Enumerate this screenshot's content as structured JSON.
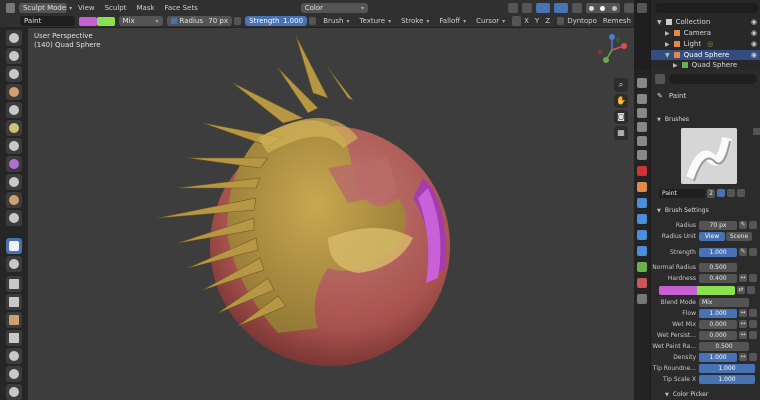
{
  "header": {
    "mode_label": "Sculpt Mode",
    "menus": [
      "View",
      "Sculpt",
      "Mask",
      "Face Sets"
    ],
    "color_field": "Color",
    "brush_name": "Paint",
    "blend": "Mix",
    "radius_label": "Radius",
    "radius_value": "70 px",
    "strength_label": "Strength",
    "strength_value": "1.000",
    "dropdowns": [
      "Brush",
      "Texture",
      "Stroke",
      "Falloff",
      "Cursor"
    ],
    "axes": [
      "X",
      "Y",
      "Z"
    ],
    "dyntopo": "Dyntopo",
    "remesh": "Remesh",
    "primary_color": "#c85fd3",
    "secondary_color": "#8be04e"
  },
  "viewport": {
    "perspective": "User Perspective",
    "object": "(140) Quad Sphere"
  },
  "outliner": {
    "search_placeholder": "",
    "items": [
      {
        "label": "Collection"
      },
      {
        "label": "Camera"
      },
      {
        "label": "Light"
      },
      {
        "label": "Quad Sphere"
      },
      {
        "label": "Quad Sphere"
      }
    ]
  },
  "properties": {
    "tool_name": "Paint",
    "brushes_header": "Brushes",
    "brush_name": "Paint",
    "brush_users": "2",
    "brush_settings_header": "Brush Settings",
    "radius_label": "Radius",
    "radius_value": "70 px",
    "radius_unit_label": "Radius Unit",
    "radius_unit_view": "View",
    "radius_unit_scene": "Scene",
    "strength_label": "Strength",
    "strength_value": "1.000",
    "normal_radius_label": "Normal Radius",
    "normal_radius_value": "0.500",
    "hardness_label": "Hardness",
    "hardness_value": "0.400",
    "blend_mode_label": "Blend Mode",
    "blend_mode_value": "Mix",
    "flow_label": "Flow",
    "flow_value": "1.000",
    "wet_mix_label": "Wet Mix",
    "wet_mix_value": "0.000",
    "wet_persist_label": "Wet Persist...",
    "wet_persist_value": "0.000",
    "wet_paint_label": "Wet Paint Ra...",
    "wet_paint_value": "0.500",
    "density_label": "Density",
    "density_value": "1.000",
    "tip_round_label": "Tip Roundne...",
    "tip_round_value": "1.000",
    "tip_scale_label": "Tip Scale X",
    "tip_scale_value": "1.000",
    "color_picker_header": "Color Picker"
  }
}
